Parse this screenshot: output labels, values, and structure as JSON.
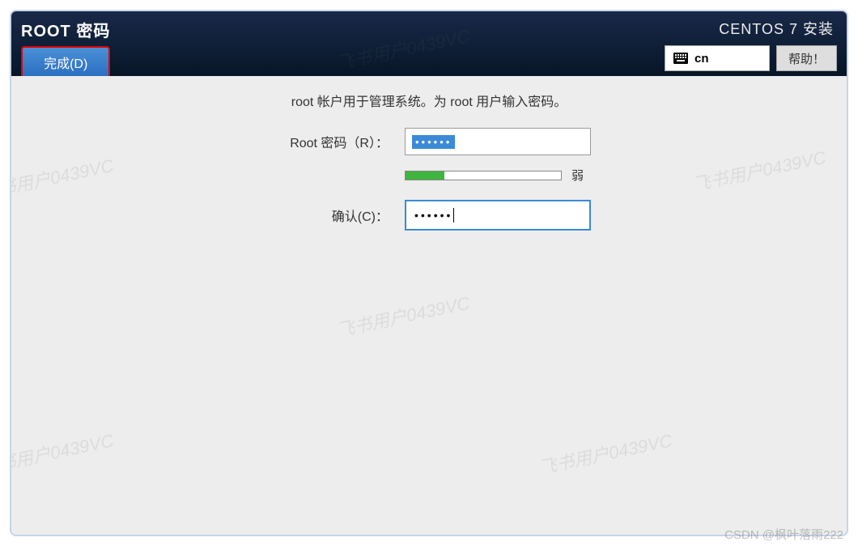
{
  "header": {
    "page_title": "ROOT 密码",
    "done_label": "完成(D)",
    "install_title": "CENTOS 7 安装",
    "language": "cn",
    "help_label": "帮助！"
  },
  "form": {
    "description": "root 帐户用于管理系统。为 root 用户输入密码。",
    "password_label": "Root 密码（R）：",
    "password_value": "••••••",
    "confirm_label": "确认(C)：",
    "confirm_value": "••••••",
    "strength_label": "弱",
    "strength_percent": 25
  },
  "watermark_text": "飞书用户0439VC",
  "credit": "CSDN @枫叶落雨222"
}
